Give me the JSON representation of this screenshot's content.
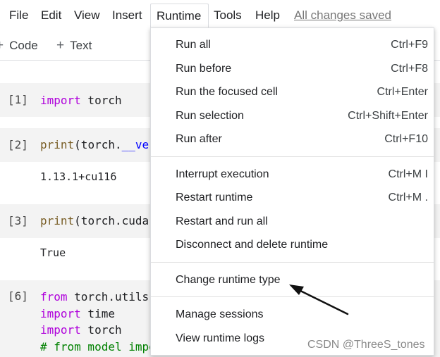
{
  "menubar": {
    "items": [
      "File",
      "Edit",
      "View",
      "Insert",
      "Runtime",
      "Tools",
      "Help"
    ],
    "saved_status": "All changes saved"
  },
  "toolbar": {
    "code_label": "Code",
    "text_label": "Text",
    "plus_glyph": "+"
  },
  "cells": [
    {
      "prompt": "[1]",
      "code": [
        [
          "import",
          " torch"
        ]
      ],
      "output": ""
    },
    {
      "prompt": "[2]",
      "code_fn": "print",
      "code_rest": "(torch.",
      "code_tail": "__ve",
      "output": "1.13.1+cu116"
    },
    {
      "prompt": "[3]",
      "code_fn": "print",
      "code_rest": "(torch.cuda",
      "output": "True"
    },
    {
      "prompt": "[6]",
      "lines": [
        {
          "kw": "from",
          "rest": " torch.utils"
        },
        {
          "kw": "import",
          "rest": " time"
        },
        {
          "kw": "import",
          "rest": " torch"
        },
        {
          "comment": "# from model impo"
        }
      ]
    }
  ],
  "runtime_menu": {
    "groups": [
      [
        {
          "label": "Run all",
          "shortcut": "Ctrl+F9"
        },
        {
          "label": "Run before",
          "shortcut": "Ctrl+F8"
        },
        {
          "label": "Run the focused cell",
          "shortcut": "Ctrl+Enter"
        },
        {
          "label": "Run selection",
          "shortcut": "Ctrl+Shift+Enter"
        },
        {
          "label": "Run after",
          "shortcut": "Ctrl+F10"
        }
      ],
      [
        {
          "label": "Interrupt execution",
          "shortcut": "Ctrl+M I"
        },
        {
          "label": "Restart runtime",
          "shortcut": "Ctrl+M ."
        },
        {
          "label": "Restart and run all",
          "shortcut": ""
        },
        {
          "label": "Disconnect and delete runtime",
          "shortcut": ""
        }
      ],
      [
        {
          "label": "Change runtime type",
          "shortcut": ""
        }
      ],
      [
        {
          "label": "Manage sessions",
          "shortcut": ""
        },
        {
          "label": "View runtime logs",
          "shortcut": ""
        }
      ]
    ]
  },
  "watermark": "CSDN @ThreeS_tones",
  "colors": {
    "keyword": "#af00db",
    "function": "#795e26",
    "comment": "#008000",
    "cell_background": "#f3f3f3",
    "annotation_arrow": "#111111"
  }
}
